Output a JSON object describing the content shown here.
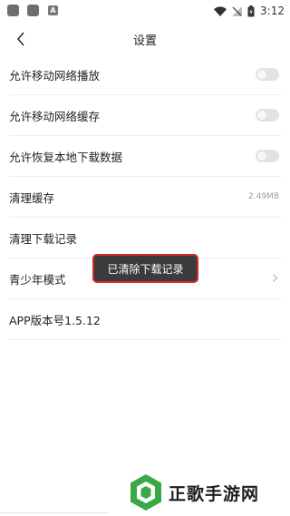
{
  "status_bar": {
    "notif_letter": "A",
    "time": "3:12"
  },
  "nav": {
    "title": "设置"
  },
  "settings": [
    {
      "label": "允许移动网络播放",
      "control": "toggle",
      "on": false
    },
    {
      "label": "允许移动网络缓存",
      "control": "toggle",
      "on": false
    },
    {
      "label": "允许恢复本地下载数据",
      "control": "toggle",
      "on": false
    },
    {
      "label": "清理缓存",
      "control": "value",
      "value": "2.49MB"
    },
    {
      "label": "清理下载记录",
      "control": "none"
    },
    {
      "label": "青少年模式",
      "control": "chevron"
    },
    {
      "label": "APP版本号1.5.12",
      "control": "none"
    }
  ],
  "toast": {
    "message": "已清除下载记录"
  },
  "watermark": {
    "text": "正歌手游网"
  },
  "colors": {
    "toast_bg": "#3b3b3b",
    "highlight_border": "#d32828",
    "toggle_off": "#e2e2e2",
    "logo_green": "#3aa845"
  }
}
